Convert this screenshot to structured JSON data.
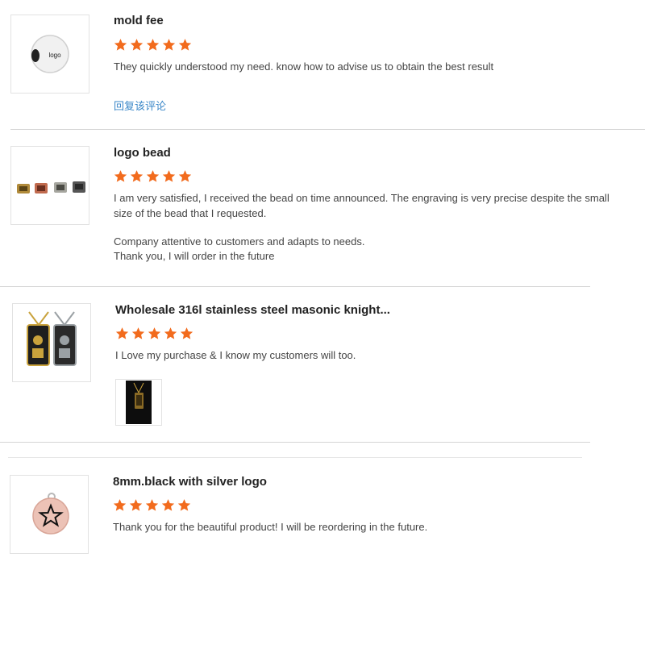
{
  "reviews": [
    {
      "title": "mold fee",
      "rating": 5,
      "text": [
        "They quickly understood my need. know how to advise us to obtain the best result"
      ],
      "reply_label": "回复该评论",
      "thumb_logo_text": "logo"
    },
    {
      "title": "logo bead",
      "rating": 5,
      "text": [
        "I am very satisfied, I received the bead on time announced. The engraving is very precise despite the small",
        "size of the bead that I requested.",
        "",
        "Company attentive to customers and adapts to needs.",
        "Thank you, I will order in the future"
      ]
    },
    {
      "title": "Wholesale 316l stainless steel masonic knight...",
      "rating": 5,
      "text": [
        "I Love my purchase & I know my customers will too."
      ],
      "photos": 1
    },
    {
      "title": "8mm.black with silver logo",
      "rating": 5,
      "text": [
        "Thank you for the beautiful product! I will be reordering in the future."
      ]
    }
  ],
  "colors": {
    "star": "#f26b1d",
    "reply_link": "#3a87c8",
    "divider": "#d4d4d4"
  }
}
